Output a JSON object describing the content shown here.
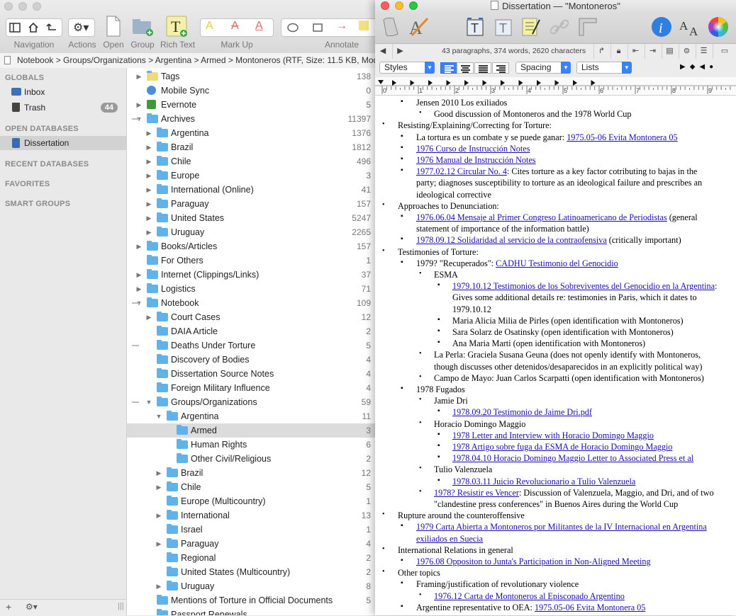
{
  "back_window": {
    "toolbar": {
      "navigation": "Navigation",
      "actions": "Actions",
      "open": "Open",
      "group": "Group",
      "rich_text": "Rich Text",
      "mark_up": "Mark Up",
      "annotate": "Annotate"
    },
    "path": "Notebook > Groups/Organizations > Argentina > Armed > Montoneros (RTF, Size: 11.5 KB, Modif",
    "sidebar": {
      "globals": "GLOBALS",
      "inbox": "Inbox",
      "trash": "Trash",
      "trash_count": "44",
      "open_databases": "OPEN DATABASES",
      "dissertation": "Dissertation",
      "recent_databases": "RECENT DATABASES",
      "favorites": "FAVORITES",
      "smart_groups": "SMART GROUPS"
    },
    "tree": [
      {
        "label": "Tags",
        "count": "138",
        "level": 0,
        "expander": "closed",
        "icon": "tag-folder-icon"
      },
      {
        "label": "Mobile Sync",
        "count": "0",
        "level": 0,
        "expander": "none",
        "icon": "sync-icon"
      },
      {
        "label": "Evernote",
        "count": "5",
        "level": 0,
        "expander": "closed",
        "icon": "evernote-icon"
      },
      {
        "label": "Archives",
        "count": "11397",
        "level": 0,
        "expander": "open",
        "icon": "folder-icon"
      },
      {
        "label": "Argentina",
        "count": "1376",
        "level": 1,
        "expander": "closed",
        "icon": "folder-icon"
      },
      {
        "label": "Brazil",
        "count": "1812",
        "level": 1,
        "expander": "closed",
        "icon": "folder-icon"
      },
      {
        "label": "Chile",
        "count": "496",
        "level": 1,
        "expander": "closed",
        "icon": "folder-icon"
      },
      {
        "label": "Europe",
        "count": "3",
        "level": 1,
        "expander": "closed",
        "icon": "folder-icon"
      },
      {
        "label": "International (Online)",
        "count": "41",
        "level": 1,
        "expander": "closed",
        "icon": "folder-icon"
      },
      {
        "label": "Paraguay",
        "count": "157",
        "level": 1,
        "expander": "closed",
        "icon": "folder-icon"
      },
      {
        "label": "United States",
        "count": "5247",
        "level": 1,
        "expander": "closed",
        "icon": "folder-icon"
      },
      {
        "label": "Uruguay",
        "count": "2265",
        "level": 1,
        "expander": "closed",
        "icon": "folder-icon"
      },
      {
        "label": "Books/Articles",
        "count": "157",
        "level": 0,
        "expander": "closed",
        "icon": "folder-icon"
      },
      {
        "label": "For Others",
        "count": "1",
        "level": 0,
        "expander": "none",
        "icon": "folder-icon"
      },
      {
        "label": "Internet (Clippings/Links)",
        "count": "37",
        "level": 0,
        "expander": "closed",
        "icon": "folder-icon"
      },
      {
        "label": "Logistics",
        "count": "71",
        "level": 0,
        "expander": "closed",
        "icon": "folder-icon"
      },
      {
        "label": "Notebook",
        "count": "109",
        "level": 0,
        "expander": "open",
        "icon": "folder-icon"
      },
      {
        "label": "Court Cases",
        "count": "12",
        "level": 1,
        "expander": "closed",
        "icon": "folder-icon"
      },
      {
        "label": "DAIA Article",
        "count": "2",
        "level": 1,
        "expander": "none",
        "icon": "folder-icon"
      },
      {
        "label": "Deaths Under Torture",
        "count": "5",
        "level": 1,
        "expander": "none",
        "icon": "folder-icon"
      },
      {
        "label": "Discovery of Bodies",
        "count": "4",
        "level": 1,
        "expander": "none",
        "icon": "folder-icon"
      },
      {
        "label": "Dissertation Source Notes",
        "count": "4",
        "level": 1,
        "expander": "none",
        "icon": "folder-icon"
      },
      {
        "label": "Foreign Military Influence",
        "count": "4",
        "level": 1,
        "expander": "none",
        "icon": "folder-icon"
      },
      {
        "label": "Groups/Organizations",
        "count": "59",
        "level": 1,
        "expander": "open",
        "icon": "folder-icon"
      },
      {
        "label": "Argentina",
        "count": "11",
        "level": 2,
        "expander": "open",
        "icon": "folder-icon"
      },
      {
        "label": "Armed",
        "count": "3",
        "level": 3,
        "expander": "none",
        "icon": "folder-icon",
        "selected": true
      },
      {
        "label": "Human Rights",
        "count": "6",
        "level": 3,
        "expander": "none",
        "icon": "folder-icon"
      },
      {
        "label": "Other Civil/Religious",
        "count": "2",
        "level": 3,
        "expander": "none",
        "icon": "folder-icon"
      },
      {
        "label": "Brazil",
        "count": "12",
        "level": 2,
        "expander": "closed",
        "icon": "folder-icon"
      },
      {
        "label": "Chile",
        "count": "5",
        "level": 2,
        "expander": "closed",
        "icon": "folder-icon"
      },
      {
        "label": "Europe (Multicountry)",
        "count": "1",
        "level": 2,
        "expander": "none",
        "icon": "folder-icon"
      },
      {
        "label": "International",
        "count": "13",
        "level": 2,
        "expander": "closed",
        "icon": "folder-icon"
      },
      {
        "label": "Israel",
        "count": "1",
        "level": 2,
        "expander": "none",
        "icon": "folder-icon"
      },
      {
        "label": "Paraguay",
        "count": "4",
        "level": 2,
        "expander": "closed",
        "icon": "folder-icon"
      },
      {
        "label": "Regional",
        "count": "2",
        "level": 2,
        "expander": "none",
        "icon": "folder-icon"
      },
      {
        "label": "United States (Multicountry)",
        "count": "2",
        "level": 2,
        "expander": "none",
        "icon": "folder-icon"
      },
      {
        "label": "Uruguay",
        "count": "8",
        "level": 2,
        "expander": "closed",
        "icon": "folder-icon"
      },
      {
        "label": "Mentions of Torture in Official Documents",
        "count": "5",
        "level": 1,
        "expander": "none",
        "icon": "folder-icon"
      },
      {
        "label": "Passport Renewals",
        "count": "",
        "level": 1,
        "expander": "none",
        "icon": "folder-icon"
      }
    ]
  },
  "front_window": {
    "title": "Dissertation — \"Montoneros\"",
    "stats": "43 paragraphs, 374 words, 2620 characters",
    "format": {
      "styles": "Styles",
      "spacing": "Spacing",
      "lists": "Lists"
    },
    "ruler_ticks": [
      "0",
      "1",
      "2",
      "3",
      "4",
      "5",
      "6",
      "7",
      "8",
      "9"
    ],
    "doc_lines": [
      {
        "bullet": "▪",
        "indent": 1,
        "parts": [
          {
            "t": "Jensen 2010 Los exiliados"
          }
        ]
      },
      {
        "bullet": "•",
        "indent": 2,
        "parts": [
          {
            "t": "Good discussion of Montoneros and the 1978 World Cup"
          }
        ]
      },
      {
        "bullet": "•",
        "indent": 0,
        "parts": [
          {
            "t": "Resisting/Explaining/Correcting for Torture:"
          }
        ]
      },
      {
        "bullet": "▪",
        "indent": 1,
        "parts": [
          {
            "t": "La tortura es un combate y se puede ganar: "
          },
          {
            "t": "1975.05-06 Evita Montonera 05",
            "link": true
          }
        ]
      },
      {
        "bullet": "▪",
        "indent": 1,
        "parts": [
          {
            "t": "1976 Curso de Instrucción Notes",
            "link": true
          }
        ]
      },
      {
        "bullet": "▪",
        "indent": 1,
        "parts": [
          {
            "t": "1976 Manual de Instrucción Notes",
            "link": true
          }
        ]
      },
      {
        "bullet": "▪",
        "indent": 1,
        "parts": [
          {
            "t": "1977.02.12 Circular No. 4",
            "link": true
          },
          {
            "t": ": Cites torture as a key factor cotributing to bajas in the"
          }
        ]
      },
      {
        "bullet": "",
        "indent": 1,
        "parts": [
          {
            "t": "party; diagnoses susceptibility to torture as an ideological failure and prescribes an"
          }
        ]
      },
      {
        "bullet": "",
        "indent": 1,
        "parts": [
          {
            "t": "ideological corrective"
          }
        ]
      },
      {
        "bullet": "•",
        "indent": 0,
        "parts": [
          {
            "t": "Approaches to Denunciation:"
          }
        ]
      },
      {
        "bullet": "▪",
        "indent": 1,
        "parts": [
          {
            "t": "1976.06.04 Mensaje al Primer Congreso Latinoamericano de Periodistas",
            "link": true
          },
          {
            "t": " (general"
          }
        ]
      },
      {
        "bullet": "",
        "indent": 1,
        "parts": [
          {
            "t": "statement of importance of the information battle)"
          }
        ]
      },
      {
        "bullet": "▪",
        "indent": 1,
        "parts": [
          {
            "t": "1978.09.12 Solidaridad al servicio de la contraofensiva",
            "link": true
          },
          {
            "t": " (critically important)"
          }
        ]
      },
      {
        "bullet": "•",
        "indent": 0,
        "parts": [
          {
            "t": "Testimonies of Torture:"
          }
        ]
      },
      {
        "bullet": "▪",
        "indent": 1,
        "parts": [
          {
            "t": "1979? \"Recuperados\": "
          },
          {
            "t": "CADHU Testimonio del Genocidio",
            "link": true
          }
        ]
      },
      {
        "bullet": "•",
        "indent": 2,
        "parts": [
          {
            "t": "ESMA"
          }
        ]
      },
      {
        "bullet": "▪",
        "indent": 3,
        "parts": [
          {
            "t": "1979.10.12 Testimonios de los Sobreviventes del Genocidio en la Argentina",
            "link": true
          },
          {
            "t": ":"
          }
        ]
      },
      {
        "bullet": "",
        "indent": 3,
        "parts": [
          {
            "t": "Gives some additional details re: testimonies in Paris, which it dates to"
          }
        ]
      },
      {
        "bullet": "",
        "indent": 3,
        "parts": [
          {
            "t": "1979.10.12"
          }
        ]
      },
      {
        "bullet": "▪",
        "indent": 3,
        "parts": [
          {
            "t": "Maria Alicia Milia de Pirles (open identification with Montoneros)"
          }
        ]
      },
      {
        "bullet": "▪",
        "indent": 3,
        "parts": [
          {
            "t": "Sara Solarz de Osatinsky (open identification with Montoneros)"
          }
        ]
      },
      {
        "bullet": "▪",
        "indent": 3,
        "parts": [
          {
            "t": "Ana Maria Marti (open identification with Montoneros)"
          }
        ]
      },
      {
        "bullet": "•",
        "indent": 2,
        "parts": [
          {
            "t": "La Perla: Graciela Susana Geuna (does not openly identify with Montoneros,"
          }
        ]
      },
      {
        "bullet": "",
        "indent": 2,
        "parts": [
          {
            "t": "though discusses other detenidos/desaparecidos in an explicitly political way)"
          }
        ]
      },
      {
        "bullet": "•",
        "indent": 2,
        "parts": [
          {
            "t": "Campo de Mayo: Juan Carlos Scarpatti (open identification with Montoneros)"
          }
        ]
      },
      {
        "bullet": "▪",
        "indent": 1,
        "parts": [
          {
            "t": "1978 Fugados"
          }
        ]
      },
      {
        "bullet": "•",
        "indent": 2,
        "parts": [
          {
            "t": "Jamie Dri"
          }
        ]
      },
      {
        "bullet": "▪",
        "indent": 3,
        "parts": [
          {
            "t": "1978.09.20 Testimonio de Jaime Dri.pdf",
            "link": true
          }
        ]
      },
      {
        "bullet": "•",
        "indent": 2,
        "parts": [
          {
            "t": "Horacio Domingo Maggio"
          }
        ]
      },
      {
        "bullet": "▪",
        "indent": 3,
        "parts": [
          {
            "t": "1978 Letter and Interview with Horacio Domingo Maggio",
            "link": true
          }
        ]
      },
      {
        "bullet": "▪",
        "indent": 3,
        "parts": [
          {
            "t": "1978 Artigo sobre fuga da ESMA de Horacio Domingo Maggio",
            "link": true
          }
        ]
      },
      {
        "bullet": "▪",
        "indent": 3,
        "parts": [
          {
            "t": "1978.04.10 Horacio Domingo Maggio Letter to Associated Press et al",
            "link": true
          }
        ]
      },
      {
        "bullet": "•",
        "indent": 2,
        "parts": [
          {
            "t": "Tulio Valenzuela"
          }
        ]
      },
      {
        "bullet": "▪",
        "indent": 3,
        "parts": [
          {
            "t": "1978.03.11 Juicio Revolucionario a Tulio Valenzuela",
            "link": true
          }
        ]
      },
      {
        "bullet": "•",
        "indent": 2,
        "parts": [
          {
            "t": "1978? Resistir es Vencer",
            "link": true
          },
          {
            "t": ": Discussion of Valenzuela, Maggio, and Dri, and of two"
          }
        ]
      },
      {
        "bullet": "",
        "indent": 2,
        "parts": [
          {
            "t": "\"clandestine press conferences\" in Buenos Aires during the World Cup"
          }
        ]
      },
      {
        "bullet": "•",
        "indent": 0,
        "parts": [
          {
            "t": "Rupture around the counteroffensive"
          }
        ]
      },
      {
        "bullet": "▪",
        "indent": 1,
        "parts": [
          {
            "t": "1979 Carta Abierta a Montoneros por Militantes de la IV Internacional en Argentina",
            "link": true
          }
        ]
      },
      {
        "bullet": "",
        "indent": 1,
        "parts": [
          {
            "t": "exiliados en Suecia",
            "link": true
          }
        ]
      },
      {
        "bullet": "•",
        "indent": 0,
        "parts": [
          {
            "t": "International Relations in general"
          }
        ]
      },
      {
        "bullet": "▪",
        "indent": 1,
        "parts": [
          {
            "t": "1976.08 Oppositon to Junta's Participation in Non-Aligned Meeting",
            "link": true
          }
        ]
      },
      {
        "bullet": "•",
        "indent": 0,
        "parts": [
          {
            "t": "Other topics"
          }
        ]
      },
      {
        "bullet": "▪",
        "indent": 1,
        "parts": [
          {
            "t": "Framing/justification of revolutionary violence"
          }
        ]
      },
      {
        "bullet": "•",
        "indent": 2,
        "parts": [
          {
            "t": "1976.12 Carta de Montoneros al Episcopado Argentino",
            "link": true
          }
        ]
      },
      {
        "bullet": "▪",
        "indent": 1,
        "parts": [
          {
            "t": "Argentine representative to OEA: "
          },
          {
            "t": "1975.05-06 Evita Montonera 05",
            "link": true
          }
        ]
      }
    ]
  }
}
